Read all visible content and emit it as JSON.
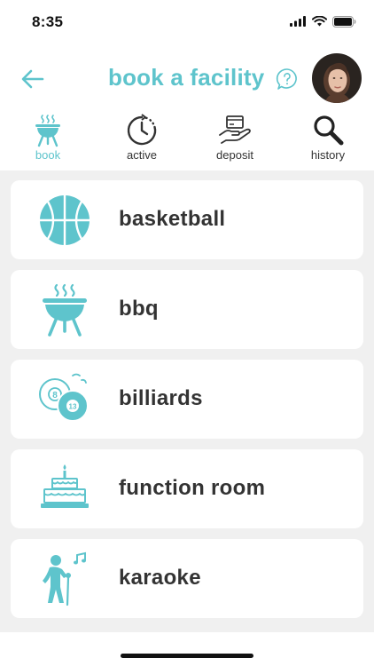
{
  "status": {
    "time": "8:35"
  },
  "header": {
    "title": "book a facility"
  },
  "tabs": [
    {
      "label": "book",
      "icon": "bbq-grill-icon",
      "active": true
    },
    {
      "label": "active",
      "icon": "clock-icon",
      "active": false
    },
    {
      "label": "deposit",
      "icon": "deposit-hand-card-icon",
      "active": false
    },
    {
      "label": "history",
      "icon": "magnifier-icon",
      "active": false
    }
  ],
  "facilities": [
    {
      "label": "basketball",
      "icon": "basketball-icon"
    },
    {
      "label": "bbq",
      "icon": "bbq-grill-icon"
    },
    {
      "label": "billiards",
      "icon": "billiard-balls-icon"
    },
    {
      "label": "function room",
      "icon": "birthday-cake-icon"
    },
    {
      "label": "karaoke",
      "icon": "singer-icon"
    }
  ],
  "colors": {
    "accent": "#5ec4cc",
    "text": "#333333",
    "list_bg": "#f0f0f0"
  }
}
